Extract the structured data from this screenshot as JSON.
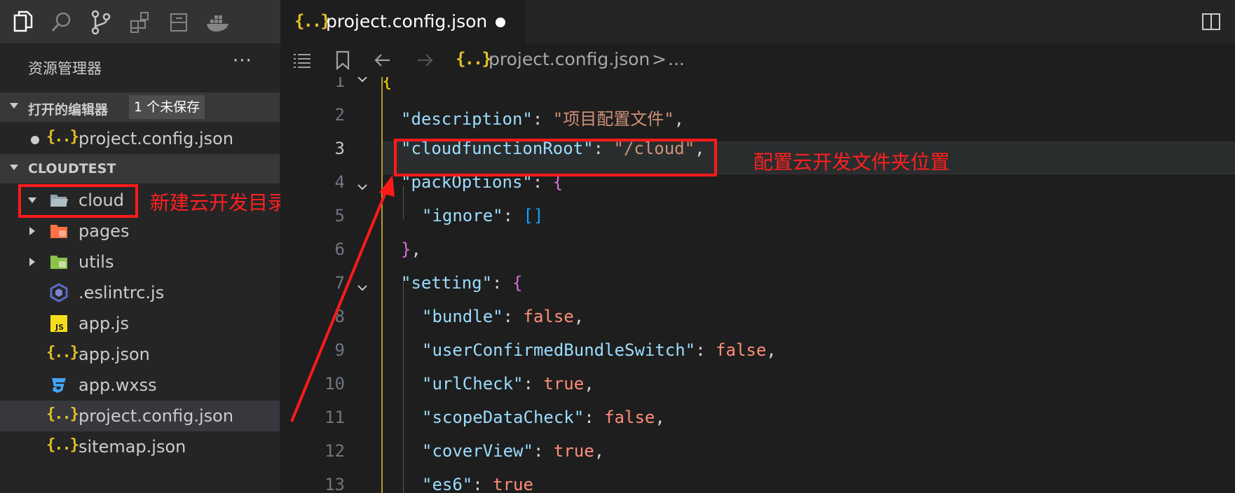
{
  "activity_bar": {
    "icons": [
      "explorer-icon",
      "search-icon",
      "source-control-icon",
      "extensions-icon",
      "remote-icon",
      "docker-icon"
    ]
  },
  "sidebar": {
    "title": "资源管理器",
    "more": "···",
    "open_editors": {
      "label": "打开的编辑器",
      "badge": "1 个未保存",
      "items": [
        {
          "name": "project.config.json",
          "icon": "json-icon",
          "dirty": true
        }
      ]
    },
    "workspace": {
      "label": "CLOUDTEST",
      "items": [
        {
          "name": "cloud",
          "icon": "folder-open-icon",
          "expanded": true
        },
        {
          "name": "pages",
          "icon": "folder-pages-icon"
        },
        {
          "name": "utils",
          "icon": "folder-utils-icon"
        },
        {
          "name": ".eslintrc.js",
          "icon": "eslint-icon"
        },
        {
          "name": "app.js",
          "icon": "js-icon"
        },
        {
          "name": "app.json",
          "icon": "json-icon"
        },
        {
          "name": "app.wxss",
          "icon": "css-icon"
        },
        {
          "name": "project.config.json",
          "icon": "json-icon",
          "selected": true
        },
        {
          "name": "sitemap.json",
          "icon": "json-icon"
        }
      ]
    }
  },
  "tab": {
    "icon_text": "{..}",
    "title": "project.config.json"
  },
  "breadcrumb": {
    "icon_text": "{..}",
    "file": "project.config.json",
    "separator": ">",
    "more": "..."
  },
  "annotations": {
    "cloud_note": "新建云开发目录",
    "config_note": "配置云开发文件夹位置"
  },
  "editor": {
    "line_numbers": [
      "1",
      "2",
      "3",
      "4",
      "5",
      "6",
      "7",
      "8",
      "9",
      "10",
      "11",
      "12",
      "13"
    ],
    "active_line": "3",
    "lines": {
      "l1": "{",
      "l2_key": "\"description\"",
      "l2_val": "\"项目配置文件\"",
      "l3_key": "\"cloudfunctionRoot\"",
      "l3_val": "\"/cloud\"",
      "l4_key": "\"packOptions\"",
      "l4_brace": "{",
      "l5_key": "\"ignore\"",
      "l5_val": "[]",
      "l6_brace": "}",
      "l7_key": "\"setting\"",
      "l7_brace": "{",
      "l8_key": "\"bundle\"",
      "l8_val": "false",
      "l9_key": "\"userConfirmedBundleSwitch\"",
      "l9_val": "false",
      "l10_key": "\"urlCheck\"",
      "l10_val": "true",
      "l11_key": "\"scopeDataCheck\"",
      "l11_val": "false",
      "l12_key": "\"coverView\"",
      "l12_val": "true",
      "l13_key": "\"es6\"",
      "l13_val": "true",
      "colon": ": ",
      "comma": ","
    }
  },
  "colors": {
    "annotation_red": "#ff1a1a",
    "json_icon": "#e2c026",
    "key": "#9cdcfe",
    "string": "#ce9178",
    "bool": "#ff8d7a"
  }
}
